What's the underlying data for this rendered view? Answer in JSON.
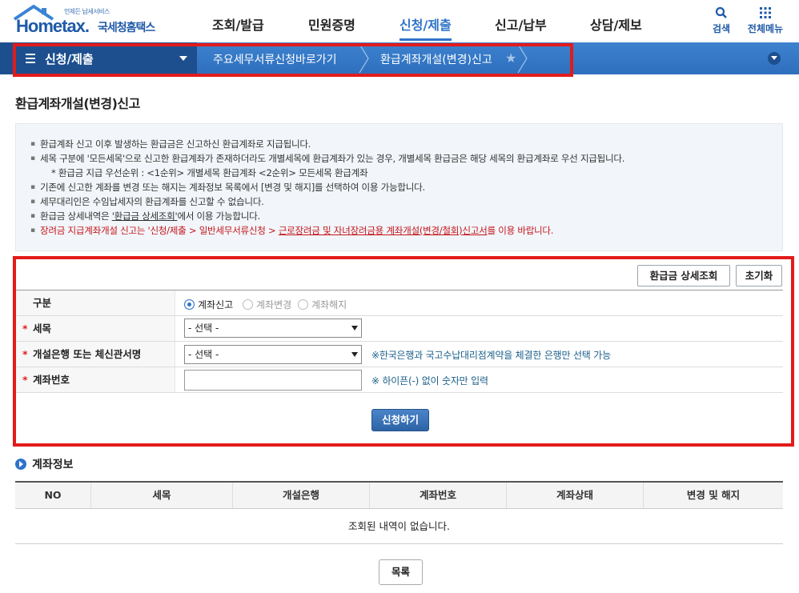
{
  "header": {
    "logo_tagline": "언제든 납세서비스",
    "logo_text": "Hometax.",
    "logo_korean": "국세청홈택스",
    "nav": [
      "조회/발급",
      "민원증명",
      "신청/제출",
      "신고/납부",
      "상담/제보"
    ],
    "active_nav": "신청/제출",
    "search_label": "검색",
    "all_menu_label": "전체메뉴"
  },
  "navbar": {
    "menu_label": "신청/제출",
    "breadcrumb_1": "주요세무서류신청바로가기",
    "breadcrumb_2": "환급계좌개설(변경)신고"
  },
  "page": {
    "title": "환급계좌개설(변경)신고"
  },
  "notice": {
    "line1": "환급계좌 신고 이후 발생하는 환급금은 신고하신 환급계좌로 지급됩니다.",
    "line2": "세목 구분에 '모든세목'으로 신고한 환급계좌가 존재하더라도 개별세목에 환급계좌가 있는 경우, 개별세목 환급금은 해당 세목의 환급계좌로 우선 지급됩니다.",
    "line3": "* 환급금 지급 우선순위 : <1순위> 개별세목 환급계좌  <2순위> 모든세목 환급계좌",
    "line4": "기존에 신고한 계좌를 변경 또는 해지는 계좌정보 목록에서 [변경 및 해지]를 선택하여 이용 가능합니다.",
    "line5": "세무대리인은 수임납세자의 환급계좌를 신고할 수 없습니다.",
    "line6_pre": "환급금 상세내역은 ",
    "line6_link": "'환급금 상세조회'",
    "line6_post": "에서 이용 가능합니다.",
    "line7_pre": "장려금 지급계좌개설 신고는 '신청/제출 > 일반세무서류신청 > ",
    "line7_link": "근로장려금 및 자녀장려금용 계좌개설(변경/철회)신고서",
    "line7_post": "를 이용 바랍니다."
  },
  "form": {
    "refund_detail_button": "환급금 상세조회",
    "reset_button": "초기화",
    "type_label": "구분",
    "type_options": [
      "계좌신고",
      "계좌변경",
      "계좌해지"
    ],
    "type_selected": "계좌신고",
    "tax_label": "세목",
    "tax_value": "- 선택 -",
    "bank_label": "개설은행 또는 체신관서명",
    "bank_value": "- 선택 -",
    "bank_hint": "※한국은행과 국고수납대리점계약을 체결한 은행만 선택 가능",
    "account_label": "계좌번호",
    "account_value": "",
    "account_hint": "※ 하이픈(-) 없이 숫자만 입력",
    "submit_button": "신청하기"
  },
  "account_info": {
    "title": "계좌정보",
    "columns": [
      "NO",
      "세목",
      "개설은행",
      "계좌번호",
      "계좌상태",
      "변경 및 해지"
    ],
    "empty_message": "조회된 내역이 없습니다.",
    "list_button": "목록"
  },
  "colors": {
    "brand_blue": "#1f5aa8",
    "nav_blue": "#3d82cf",
    "highlight_red": "#e21b1b"
  }
}
